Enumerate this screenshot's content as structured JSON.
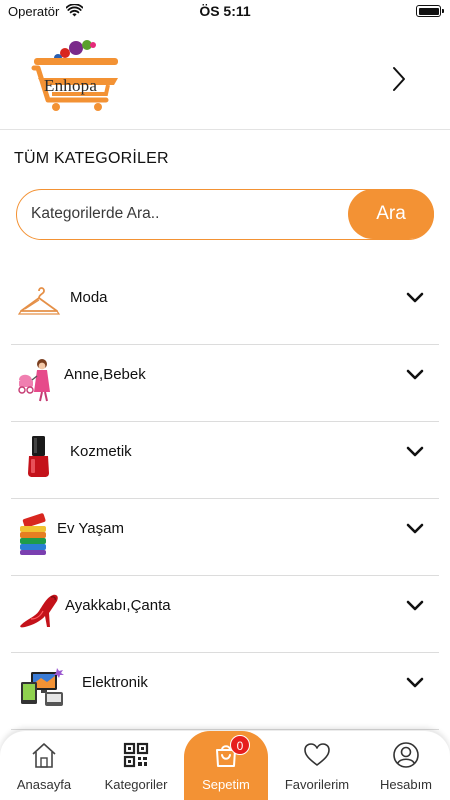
{
  "status_bar": {
    "carrier": "Operatör",
    "time": "ÖS 5:11"
  },
  "header": {
    "logo_text": "Enhopa",
    "next_icon": "chevron-right-icon"
  },
  "page": {
    "section_title": "TÜM KATEGORİLER"
  },
  "search": {
    "placeholder": "Kategorilerde Ara..",
    "value": "",
    "button_label": "Ara"
  },
  "categories": [
    {
      "label": "Moda",
      "icon": "hanger-icon"
    },
    {
      "label": "Anne,Bebek",
      "icon": "mother-stroller-icon"
    },
    {
      "label": "Kozmetik",
      "icon": "nail-polish-icon"
    },
    {
      "label": "Ev Yaşam",
      "icon": "towels-icon"
    },
    {
      "label": "Ayakkabı,Çanta",
      "icon": "high-heel-icon"
    },
    {
      "label": "Elektronik",
      "icon": "electronics-icon"
    }
  ],
  "tab_bar": {
    "tabs": [
      {
        "label": "Anasayfa",
        "icon": "home-icon"
      },
      {
        "label": "Kategoriler",
        "icon": "qr-code-icon"
      },
      {
        "label": "Sepetim",
        "icon": "shopping-bag-icon",
        "badge": "0",
        "active": true
      },
      {
        "label": "Favorilerim",
        "icon": "heart-icon"
      },
      {
        "label": "Hesabım",
        "icon": "user-icon"
      }
    ]
  },
  "colors": {
    "accent": "#f39234",
    "badge": "#e61e1e",
    "divider": "#dcdcdc"
  }
}
